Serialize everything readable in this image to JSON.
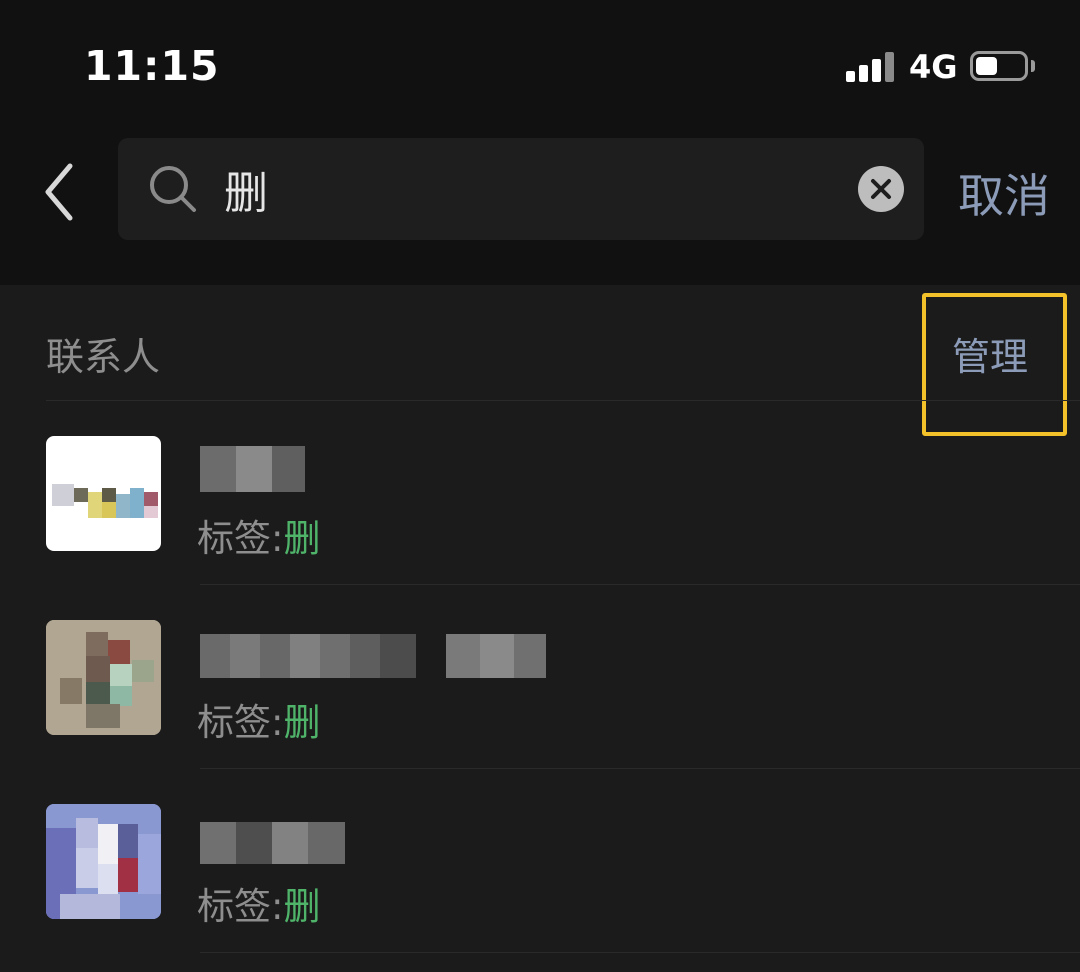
{
  "status_bar": {
    "time": "11:15",
    "network": "4G",
    "signal_bars": 4,
    "battery_level": 0.45
  },
  "search": {
    "query": "删",
    "cancel_label": "取消"
  },
  "section": {
    "title": "联系人",
    "manage_label": "管理"
  },
  "contacts": [
    {
      "tag_prefix": "标签:",
      "tag_match": "删"
    },
    {
      "tag_prefix": "标签:",
      "tag_match": "删"
    },
    {
      "tag_prefix": "标签:",
      "tag_match": "删"
    }
  ],
  "colors": {
    "background": "#1b1b1b",
    "header_background": "#111111",
    "accent_link": "#8c9cb8",
    "tag_match_green": "#4fb36a",
    "highlight_yellow": "#f3c12a"
  },
  "icons": {
    "back": "chevron-left-icon",
    "search": "search-icon",
    "clear": "clear-circle-x-icon",
    "signal": "cellular-signal-icon",
    "battery": "battery-icon"
  }
}
